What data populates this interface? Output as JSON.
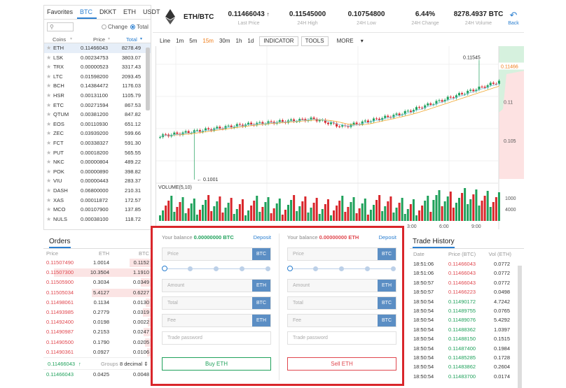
{
  "market": {
    "tabs": [
      "Favorites",
      "BTC",
      "DKKT",
      "ETH",
      "USDT"
    ],
    "active_tab": "BTC",
    "search_icon": "search-icon",
    "radio_change": "Change",
    "radio_total": "Total",
    "col_coins": "Coins",
    "col_price": "Price",
    "col_total": "Total",
    "rows": [
      {
        "coin": "ETH",
        "price": "0.11466043",
        "total": "8278.49"
      },
      {
        "coin": "LSK",
        "price": "0.00234753",
        "total": "3803.07"
      },
      {
        "coin": "TRX",
        "price": "0.00000523",
        "total": "3317.43"
      },
      {
        "coin": "LTC",
        "price": "0.01598200",
        "total": "2093.45"
      },
      {
        "coin": "BCH",
        "price": "0.14384472",
        "total": "1176.03"
      },
      {
        "coin": "HSR",
        "price": "0.00131100",
        "total": "1105.79"
      },
      {
        "coin": "ETC",
        "price": "0.00271594",
        "total": "867.53"
      },
      {
        "coin": "QTUM",
        "price": "0.00381200",
        "total": "847.82"
      },
      {
        "coin": "EOS",
        "price": "0.00110930",
        "total": "651.12"
      },
      {
        "coin": "ZEC",
        "price": "0.03939200",
        "total": "599.66"
      },
      {
        "coin": "FCT",
        "price": "0.00338327",
        "total": "591.30"
      },
      {
        "coin": "PUT",
        "price": "0.00018200",
        "total": "565.55"
      },
      {
        "coin": "NKC",
        "price": "0.00000804",
        "total": "489.22"
      },
      {
        "coin": "POK",
        "price": "0.00000890",
        "total": "398.82"
      },
      {
        "coin": "VIU",
        "price": "0.00000443",
        "total": "283.37"
      },
      {
        "coin": "DASH",
        "price": "0.06800000",
        "total": "210.31"
      },
      {
        "coin": "XAS",
        "price": "0.00011872",
        "total": "172.57"
      },
      {
        "coin": "MCO",
        "price": "0.00107900",
        "total": "137.85"
      },
      {
        "coin": "NULS",
        "price": "0.00038100",
        "total": "118.72"
      }
    ]
  },
  "header": {
    "pair": "ETH/BTC",
    "last_price": "0.11466043",
    "last_price_label": "Last Price",
    "high": "0.11545000",
    "high_label": "24H High",
    "low": "0.10754800",
    "low_label": "24H Low",
    "change": "6.44%",
    "change_label": "24H Change",
    "volume": "8278.4937 BTC",
    "volume_label": "24H Volume",
    "back_label": "Back"
  },
  "toolbar": {
    "intervals": [
      "Line",
      "1m",
      "5m",
      "15m",
      "30m",
      "1h",
      "1d"
    ],
    "active_interval": "15m",
    "indicator": "INDICATOR",
    "tools": "TOOLS",
    "more": "MORE"
  },
  "chart_data": {
    "type": "candlestick",
    "high_label": "0.11545",
    "low_label": "0.1001",
    "price_ticks": [
      "0.11",
      "0.105"
    ],
    "last_tag": "0.11466",
    "volume_label": "VOLUME(5,10)",
    "volume_ticks": [
      "1000",
      "4000"
    ],
    "time_ticks": [
      "3:00",
      "6:00",
      "9:00"
    ],
    "colors": {
      "up": "#1fa15b",
      "down": "#d9262b",
      "ma": "#f0a830",
      "ma2": "#7ec8e3"
    }
  },
  "orders": {
    "title": "Orders",
    "col_price": "Price",
    "col_eth": "ETH",
    "col_btc": "BTC",
    "sells": [
      {
        "price": "0.11507490",
        "eth": "1.0014",
        "btc": "0.1152",
        "depth": 0.2
      },
      {
        "price": "0.11507300",
        "eth": "10.3504",
        "btc": "1.1910",
        "depth": 0.9
      },
      {
        "price": "0.11505900",
        "eth": "0.3034",
        "btc": "0.0349",
        "depth": 0.1
      },
      {
        "price": "0.11505034",
        "eth": "5.4127",
        "btc": "0.6227",
        "depth": 0.55
      },
      {
        "price": "0.11498061",
        "eth": "0.1134",
        "btc": "0.0130",
        "depth": 0.05
      },
      {
        "price": "0.11493985",
        "eth": "0.2779",
        "btc": "0.0319",
        "depth": 0.08
      },
      {
        "price": "0.11492400",
        "eth": "0.0198",
        "btc": "0.0022",
        "depth": 0.03
      },
      {
        "price": "0.11490987",
        "eth": "0.2153",
        "btc": "0.0247",
        "depth": 0.07
      },
      {
        "price": "0.11490500",
        "eth": "0.1790",
        "btc": "0.0205",
        "depth": 0.06
      },
      {
        "price": "0.11490361",
        "eth": "0.0927",
        "btc": "0.0106",
        "depth": 0.04
      }
    ],
    "last_price": "0.11466043",
    "groups_label": "Groups",
    "groups_value": "8 decimal",
    "buys": [
      {
        "price": "0.11466043",
        "eth": "0.0425",
        "btc": "0.0048"
      }
    ]
  },
  "trade": {
    "buy": {
      "balance_label": "Your balance",
      "balance_value": "0.00000000 BTC",
      "deposit": "Deposit",
      "price_ph": "Price",
      "price_unit": "BTC",
      "amount_ph": "Amount",
      "amount_unit": "ETH",
      "total_ph": "Total",
      "total_unit": "BTC",
      "fee_ph": "Fee",
      "fee_unit": "ETH",
      "password_ph": "Trade password",
      "button": "Buy ETH"
    },
    "sell": {
      "balance_label": "Your balance",
      "balance_value": "0.00000000 ETH",
      "deposit": "Deposit",
      "price_ph": "Price",
      "price_unit": "BTC",
      "amount_ph": "Amount",
      "amount_unit": "ETH",
      "total_ph": "Total",
      "total_unit": "BTC",
      "fee_ph": "Fee",
      "fee_unit": "BTC",
      "password_ph": "Trade password",
      "button": "Sell ETH"
    }
  },
  "history": {
    "title": "Trade History",
    "col_date": "Date",
    "col_price": "Price (BTC)",
    "col_vol": "Vol (ETH)",
    "rows": [
      {
        "date": "18:51:06",
        "price": "0.11466043",
        "vol": "0.0772",
        "side": "sell"
      },
      {
        "date": "18:51:06",
        "price": "0.11466043",
        "vol": "0.0772",
        "side": "sell"
      },
      {
        "date": "18:50:57",
        "price": "0.11466043",
        "vol": "0.0772",
        "side": "sell"
      },
      {
        "date": "18:50:57",
        "price": "0.11466223",
        "vol": "0.0498",
        "side": "sell"
      },
      {
        "date": "18:50:54",
        "price": "0.11490172",
        "vol": "4.7242",
        "side": "buy"
      },
      {
        "date": "18:50:54",
        "price": "0.11489755",
        "vol": "0.0765",
        "side": "buy"
      },
      {
        "date": "18:50:54",
        "price": "0.11489076",
        "vol": "5.4292",
        "side": "buy"
      },
      {
        "date": "18:50:54",
        "price": "0.11488362",
        "vol": "1.0397",
        "side": "buy"
      },
      {
        "date": "18:50:54",
        "price": "0.11488150",
        "vol": "0.1515",
        "side": "buy"
      },
      {
        "date": "18:50:54",
        "price": "0.11487400",
        "vol": "0.1984",
        "side": "buy"
      },
      {
        "date": "18:50:54",
        "price": "0.11485285",
        "vol": "0.1728",
        "side": "buy"
      },
      {
        "date": "18:50:54",
        "price": "0.11483862",
        "vol": "0.2604",
        "side": "buy"
      },
      {
        "date": "18:50:54",
        "price": "0.11483700",
        "vol": "0.0174",
        "side": "buy"
      }
    ]
  }
}
